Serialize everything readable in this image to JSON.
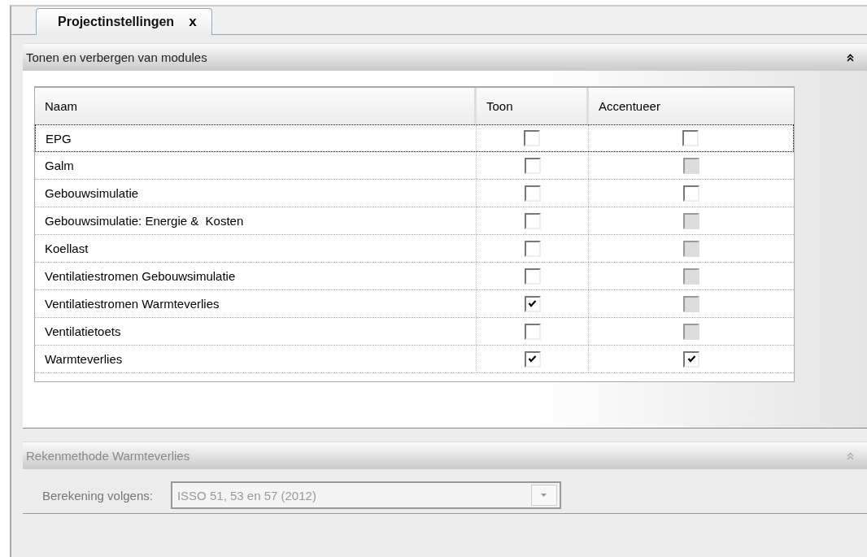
{
  "tab": {
    "title": "Projectinstellingen",
    "close": "x"
  },
  "modules_panel": {
    "title": "Tonen en verbergen van modules"
  },
  "table": {
    "columns": [
      "Naam",
      "Toon",
      "Accentueer"
    ],
    "rows": [
      {
        "name": "EPG",
        "show": {
          "checked": false,
          "disabled": false
        },
        "highlight": {
          "checked": false,
          "disabled": false
        },
        "selected": true
      },
      {
        "name": "Galm",
        "show": {
          "checked": false,
          "disabled": false
        },
        "highlight": {
          "checked": false,
          "disabled": true
        },
        "selected": false
      },
      {
        "name": "Gebouwsimulatie",
        "show": {
          "checked": false,
          "disabled": false
        },
        "highlight": {
          "checked": false,
          "disabled": false
        },
        "selected": false
      },
      {
        "name": "Gebouwsimulatie: Energie &  Kosten",
        "show": {
          "checked": false,
          "disabled": false
        },
        "highlight": {
          "checked": false,
          "disabled": true
        },
        "selected": false
      },
      {
        "name": "Koellast",
        "show": {
          "checked": false,
          "disabled": false
        },
        "highlight": {
          "checked": false,
          "disabled": true
        },
        "selected": false
      },
      {
        "name": "Ventilatiestromen Gebouwsimulatie",
        "show": {
          "checked": false,
          "disabled": false
        },
        "highlight": {
          "checked": false,
          "disabled": true
        },
        "selected": false
      },
      {
        "name": "Ventilatiestromen Warmteverlies",
        "show": {
          "checked": true,
          "disabled": false
        },
        "highlight": {
          "checked": false,
          "disabled": true
        },
        "selected": false
      },
      {
        "name": "Ventilatietoets",
        "show": {
          "checked": false,
          "disabled": false
        },
        "highlight": {
          "checked": false,
          "disabled": true
        },
        "selected": false
      },
      {
        "name": "Warmteverlies",
        "show": {
          "checked": true,
          "disabled": false
        },
        "highlight": {
          "checked": true,
          "disabled": false
        },
        "selected": false
      }
    ]
  },
  "method_panel": {
    "title": "Rekenmethode Warmteverlies",
    "disabled": true,
    "field_label": "Berekening volgens:",
    "value": "ISSO 51, 53 en 57 (2012)"
  }
}
